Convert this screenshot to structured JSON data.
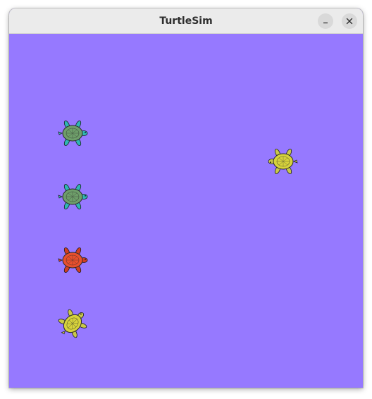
{
  "window": {
    "title": "TurtleSim",
    "background_color": "#9679ff",
    "titlebar_color": "#ebebeb"
  },
  "titlebar_buttons": {
    "minimize_icon": "minimize-icon",
    "close_icon": "close-icon"
  },
  "turtles": [
    {
      "id": "turtle-1",
      "shell_color": "#6e9e6a",
      "limb_color": "#2fb7b3",
      "heading": "right"
    },
    {
      "id": "turtle-2",
      "shell_color": "#6e9e6a",
      "limb_color": "#2fb7b3",
      "heading": "right"
    },
    {
      "id": "turtle-3",
      "shell_color": "#e8502d",
      "limb_color": "#d13f22",
      "heading": "right"
    },
    {
      "id": "turtle-4",
      "shell_color": "#d6d23c",
      "limb_color": "#c9c84a",
      "heading": "up-right"
    },
    {
      "id": "turtle-5",
      "shell_color": "#d6d23c",
      "limb_color": "#c9c84a",
      "heading": "left"
    }
  ]
}
